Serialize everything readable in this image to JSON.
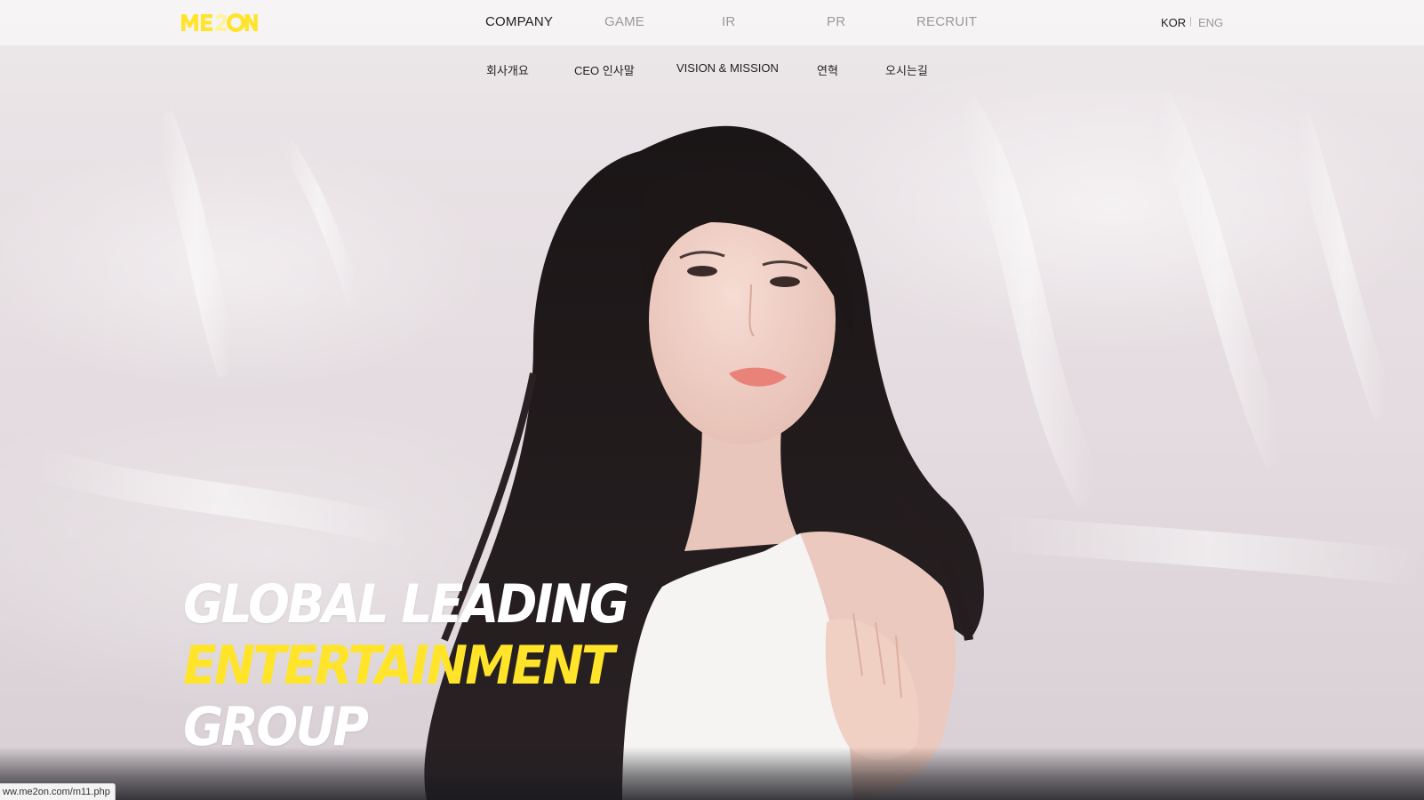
{
  "brand": {
    "logo_text": "ME2ON",
    "accent_color": "#ffe42a"
  },
  "main_nav": {
    "items": [
      {
        "label": "COMPANY",
        "active": true
      },
      {
        "label": "GAME",
        "active": false
      },
      {
        "label": "IR",
        "active": false
      },
      {
        "label": "PR",
        "active": false
      },
      {
        "label": "RECRUIT",
        "active": false
      }
    ]
  },
  "language": {
    "kor": "KOR",
    "separator": "|",
    "eng": "ENG",
    "active": "KOR"
  },
  "sub_nav": {
    "items": [
      {
        "label": "회사개요"
      },
      {
        "label": "CEO 인사말"
      },
      {
        "label": "VISION & MISSION"
      },
      {
        "label": "연혁"
      },
      {
        "label": "오시는길"
      }
    ]
  },
  "hero": {
    "line1": "GLOBAL LEADING",
    "line2": "ENTERTAINMENT",
    "line3": "GROUP"
  },
  "status_bar": {
    "url": "ww.me2on.com/m11.php"
  }
}
